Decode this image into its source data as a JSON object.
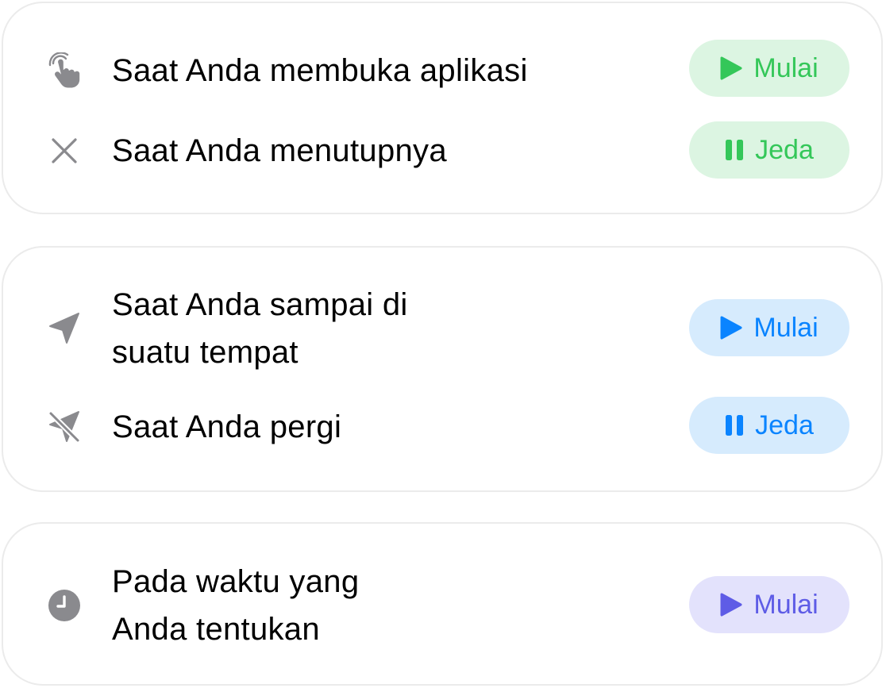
{
  "colors": {
    "card_border": "#ebebeb",
    "icon_gray": "#8a8a8e",
    "green_text": "#34c759",
    "green_bg": "#dcf5e2",
    "blue_text": "#0a84ff",
    "blue_bg": "#d6ebfd",
    "purple_text": "#5e5ce6",
    "purple_bg": "#e3e2fc"
  },
  "app_group": {
    "open": {
      "icon": "tap-hand-icon",
      "label": "Saat Anda membuka aplikasi",
      "button": {
        "icon": "play-icon",
        "label": "Mulai"
      }
    },
    "close": {
      "icon": "close-icon",
      "label": "Saat Anda menutupnya",
      "button": {
        "icon": "pause-icon",
        "label": "Jeda"
      }
    }
  },
  "location_group": {
    "arrive": {
      "icon": "location-arrow-icon",
      "label": "Saat Anda sampai di\nsuatu tempat",
      "button": {
        "icon": "play-icon",
        "label": "Mulai"
      }
    },
    "leave": {
      "icon": "location-arrow-slash-icon",
      "label": "Saat Anda pergi",
      "button": {
        "icon": "pause-icon",
        "label": "Jeda"
      }
    }
  },
  "time_group": {
    "scheduled": {
      "icon": "clock-icon",
      "label": "Pada waktu yang\nAnda tentukan",
      "button": {
        "icon": "play-icon",
        "label": "Mulai"
      }
    }
  }
}
